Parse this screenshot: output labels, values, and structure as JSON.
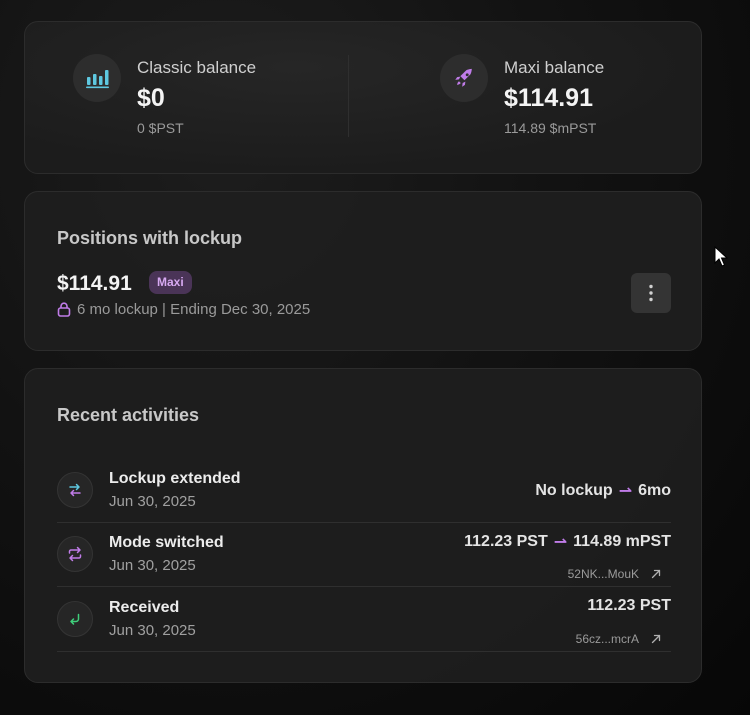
{
  "balances": {
    "classic": {
      "title": "Classic balance",
      "value": "$0",
      "sub": "0 $PST",
      "icon": "bar-chart-icon"
    },
    "maxi": {
      "title": "Maxi balance",
      "value": "$114.91",
      "sub": "114.89 $mPST",
      "icon": "rocket-icon"
    }
  },
  "positions": {
    "title": "Positions with lockup",
    "amount": "$114.91",
    "badge": "Maxi",
    "lockup_text": "6 mo lockup | Ending Dec 30, 2025"
  },
  "activities": {
    "title": "Recent activities",
    "items": [
      {
        "title": "Lockup extended",
        "date": "Jun 30, 2025",
        "from": "No lockup",
        "to": "6mo",
        "icon": "transfer-arrows-icon"
      },
      {
        "title": "Mode switched",
        "date": "Jun 30, 2025",
        "from": "112.23 PST",
        "to": "114.89 mPST",
        "tx": "52NK...MouK",
        "icon": "swap-icon"
      },
      {
        "title": "Received",
        "date": "Jun 30, 2025",
        "amount": "112.23 PST",
        "tx": "56cz...mcrA",
        "icon": "receive-arrow-icon"
      }
    ]
  },
  "colors": {
    "accent": "#c07ce8",
    "teal": "#5ec8e0",
    "green": "#3ecf7a"
  }
}
